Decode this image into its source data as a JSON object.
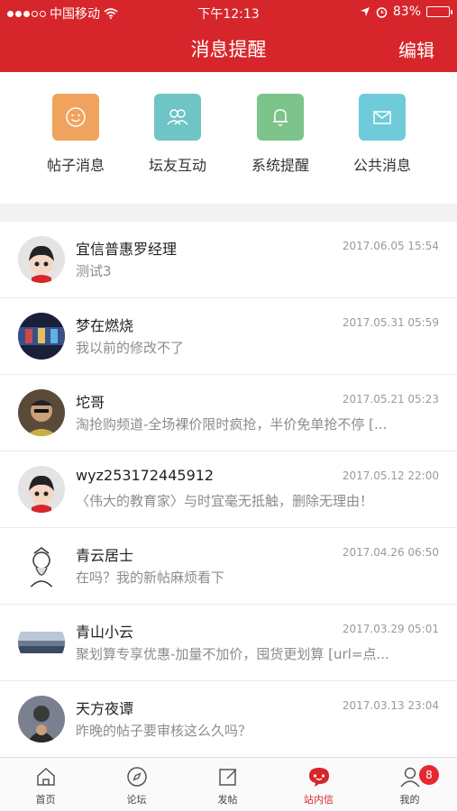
{
  "status_bar": {
    "carrier": "中国移动",
    "time": "下午12:13",
    "battery": "83%",
    "battery_level": 0.83
  },
  "nav": {
    "title": "消息提醒",
    "edit_label": "编辑"
  },
  "categories": [
    {
      "label": "帖子消息",
      "icon": "smiley-icon",
      "color": "#f0a35c"
    },
    {
      "label": "坛友互动",
      "icon": "users-icon",
      "color": "#6fc4c6"
    },
    {
      "label": "系统提醒",
      "icon": "bell-icon",
      "color": "#7cc48a"
    },
    {
      "label": "公共消息",
      "icon": "mail-icon",
      "color": "#6fcbd9"
    }
  ],
  "messages": [
    {
      "name": "宜信普惠罗经理",
      "time": "2017.06.05 15:54",
      "preview": "测试3"
    },
    {
      "name": "梦在燃烧",
      "time": "2017.05.31 05:59",
      "preview": "我以前的修改不了"
    },
    {
      "name": "坨哥",
      "time": "2017.05.21 05:23",
      "preview": "淘抢购频道-全场裸价限时疯抢，半价免单抢不停 [..."
    },
    {
      "name": "wyz253172445912",
      "time": "2017.05.12 22:00",
      "preview": "〈伟大的教育家〉与时宜毫无抵触，删除无理由！"
    },
    {
      "name": "青云居士",
      "time": "2017.04.26 06:50",
      "preview": "在吗？我的新帖麻烦看下"
    },
    {
      "name": "青山小云",
      "time": "2017.03.29 05:01",
      "preview": "聚划算专享优惠-加量不加价，囤货更划算 [url=点..."
    },
    {
      "name": "天方夜谭",
      "time": "2017.03.13 23:04",
      "preview": "昨晚的帖子要审核这么久吗？"
    }
  ],
  "tabs": [
    {
      "label": "首页",
      "icon": "home-icon",
      "active": false
    },
    {
      "label": "论坛",
      "icon": "compass-icon",
      "active": false
    },
    {
      "label": "发帖",
      "icon": "compose-icon",
      "active": false
    },
    {
      "label": "站内信",
      "icon": "chat-icon",
      "active": true
    },
    {
      "label": "我的",
      "icon": "user-icon",
      "active": false
    }
  ],
  "badge_count": "8",
  "colors": {
    "brand_red": "#d7262b",
    "badge_red": "#e6282e"
  }
}
